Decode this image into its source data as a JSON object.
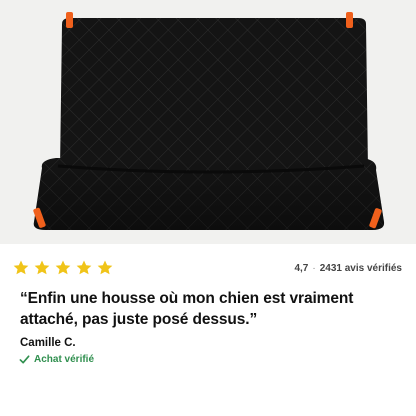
{
  "product": {
    "image_alt": "Housse de banquette matelassée noire avec attaches orange"
  },
  "review": {
    "stars": 5,
    "rating_text": "4,7",
    "separator": "·",
    "count_text": "2431 avis vérifiés",
    "quote": "“Enfin une housse où mon chien est vraiment attaché, pas juste posé dessus.”",
    "author": "Camille C.",
    "verified_label": "Achat vérifié"
  },
  "colors": {
    "star": "#f0c419",
    "verified": "#2f8f4e",
    "accent": "#f0601c",
    "cover": "#151515"
  }
}
